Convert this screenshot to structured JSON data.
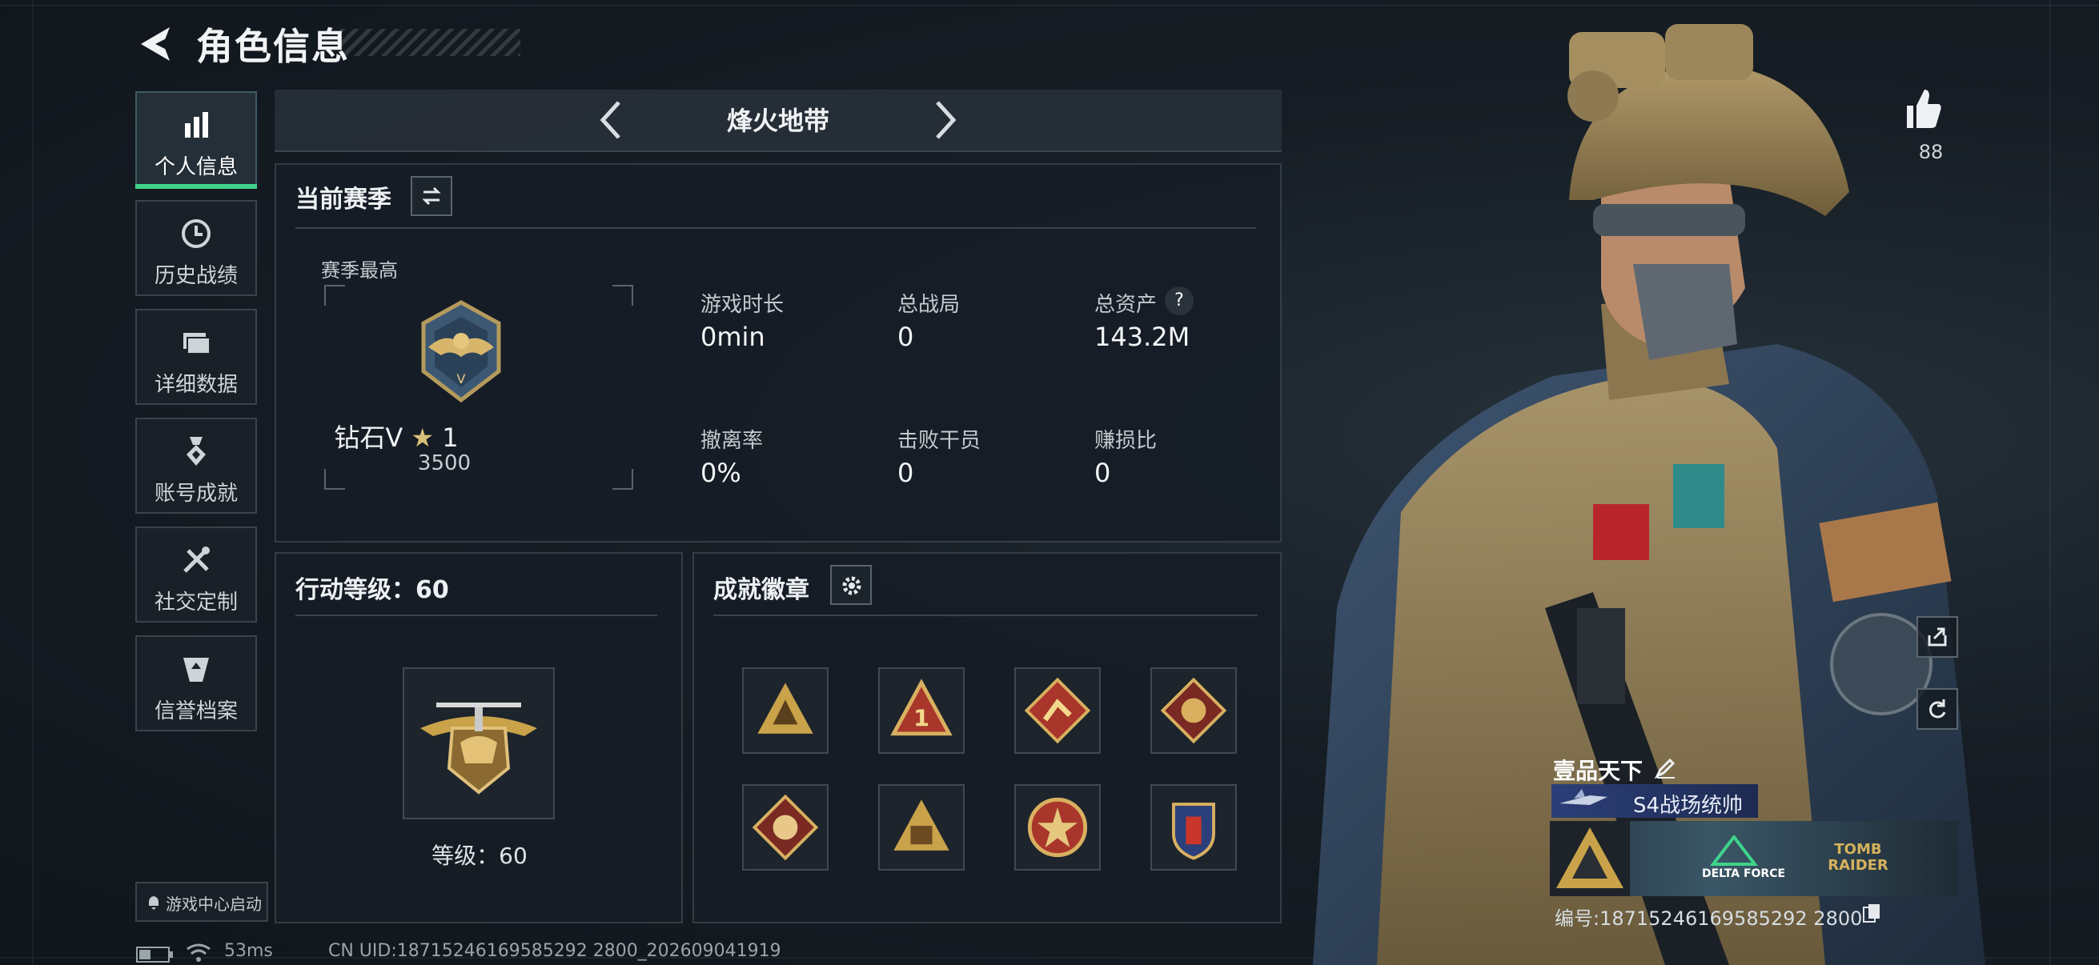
{
  "header": {
    "title": "角色信息"
  },
  "nav": {
    "items": [
      {
        "label": "个人信息",
        "icon": "bar-chart-icon"
      },
      {
        "label": "历史战绩",
        "icon": "clock-icon"
      },
      {
        "label": "详细数据",
        "icon": "folders-icon"
      },
      {
        "label": "账号成就",
        "icon": "medal-icon"
      },
      {
        "label": "社交定制",
        "icon": "tools-icon"
      },
      {
        "label": "信誉档案",
        "icon": "shield-icon"
      }
    ],
    "launch_label": "游戏中心启动"
  },
  "mode": {
    "label": "烽火地带"
  },
  "season": {
    "title": "当前赛季",
    "peak_label": "赛季最高",
    "rank_name": "钻石V",
    "rank_stars": "1",
    "rank_score": "3500",
    "stats": [
      {
        "label": "游戏时长",
        "value": "0min"
      },
      {
        "label": "总战局",
        "value": "0"
      },
      {
        "label": "总资产",
        "value": "143.2M"
      },
      {
        "label": "撤离率",
        "value": "0%"
      },
      {
        "label": "击败干员",
        "value": "0"
      },
      {
        "label": "赚损比",
        "value": "0"
      }
    ],
    "help_glyph": "?"
  },
  "action_level": {
    "title": "行动等级：60",
    "level_text": "等级：60"
  },
  "achievements": {
    "title": "成就徽章",
    "badges": [
      "badge-1",
      "badge-2",
      "badge-3",
      "badge-4",
      "badge-5",
      "badge-6",
      "badge-7",
      "badge-8"
    ]
  },
  "profile": {
    "likes": "88",
    "player_name": "壹品天下",
    "title_text": "S4战场统帅",
    "uid_line": "编号:18715246169585292 2800",
    "banner_brand_1": "DELTA FORCE",
    "banner_brand_2": "TOMB RAIDER"
  },
  "status_bar": {
    "ping": "53ms",
    "uid": "CN UID:18715246169585292 2800_202609041919"
  },
  "colors": {
    "accent": "#3fd38b",
    "title_bar": "#2c3f78",
    "gold": "#c9a24a"
  }
}
